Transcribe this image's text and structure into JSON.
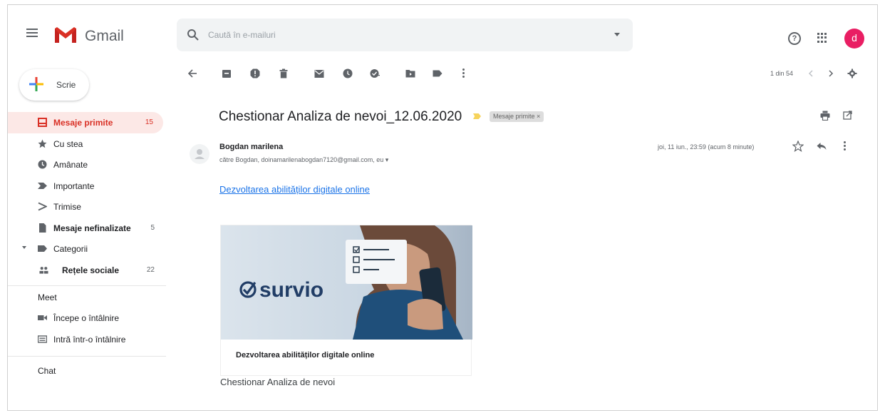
{
  "app": {
    "name": "Gmail",
    "brand_color": "#d93025",
    "accent_color": "#1a73e8"
  },
  "search": {
    "placeholder": "Caută în e-mailuri"
  },
  "account": {
    "avatar_letter": "d",
    "avatar_color": "#e91e63"
  },
  "compose": {
    "label": "Scrie"
  },
  "sidebar": {
    "items": [
      {
        "label": "Mesaje primite",
        "count": "15",
        "icon": "inbox-icon",
        "active": true
      },
      {
        "label": "Cu stea",
        "count": "",
        "icon": "star-icon"
      },
      {
        "label": "Amânate",
        "count": "",
        "icon": "clock-icon"
      },
      {
        "label": "Importante",
        "count": "",
        "icon": "important-icon"
      },
      {
        "label": "Trimise",
        "count": "",
        "icon": "send-icon"
      },
      {
        "label": "Mesaje nefinalizate",
        "count": "5",
        "icon": "draft-icon"
      },
      {
        "label": "Categorii",
        "count": "",
        "icon": "label-icon"
      },
      {
        "label": "Rețele sociale",
        "count": "22",
        "icon": "people-icon"
      }
    ],
    "meet_title": "Meet",
    "meet_items": [
      {
        "label": "Începe o întâlnire",
        "icon": "video-icon"
      },
      {
        "label": "Intră într-o întâlnire",
        "icon": "keyboard-icon"
      }
    ],
    "chat_title": "Chat"
  },
  "toolbar": {
    "pager": "1 din 54"
  },
  "message": {
    "subject": "Chestionar Analiza de nevoi_12.06.2020",
    "label_chip": "Mesaje primite ×",
    "sender": "Bogdan marilena",
    "recipients": "către Bogdan, doinamarilenabogdan7120@gmail.com, eu ▾",
    "date": "joi, 11 iun., 23:59 (acum 8 minute)",
    "link_text": "Dezvoltarea abilităților digitale online",
    "card_logo": "survio",
    "card_caption": "Dezvoltarea abilităților digitale online",
    "footer_text": "Chestionar Analiza de nevoi"
  }
}
